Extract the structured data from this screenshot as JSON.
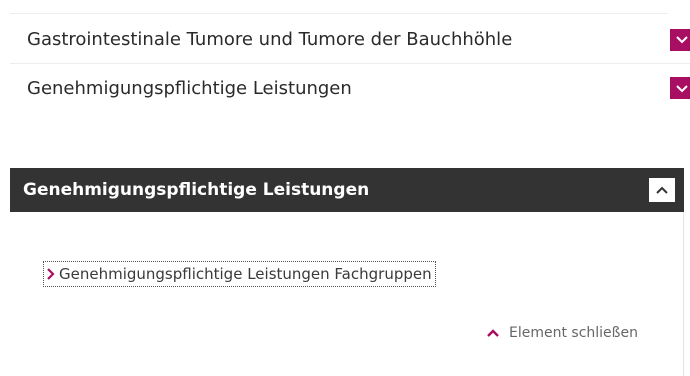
{
  "accordion": {
    "items": [
      {
        "label": "Gastrointestinale Tumore und Tumore der Bauchhöhle",
        "icon": "chevron-down-icon"
      },
      {
        "label": "Genehmigungspflichtige Leistungen",
        "icon": "chevron-down-icon"
      }
    ]
  },
  "panel": {
    "title": "Genehmigungspflichtige Leistungen",
    "collapse_icon": "chevron-up-icon",
    "link": {
      "label": "Genehmigungspflichtige Leistungen Fachgruppen",
      "icon": "chevron-right-icon"
    },
    "close": {
      "label": "Element schließen",
      "icon": "chevron-up-icon"
    }
  },
  "colors": {
    "accent": "#a80f62",
    "header_bg": "#333333",
    "text": "#2a2a2a"
  }
}
